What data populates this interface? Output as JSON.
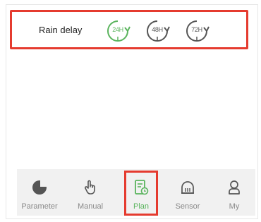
{
  "rain_delay": {
    "label": "Rain delay",
    "options": [
      {
        "label": "24H",
        "selected": true
      },
      {
        "label": "48H",
        "selected": false
      },
      {
        "label": "72H",
        "selected": false
      }
    ]
  },
  "tabbar": {
    "items": [
      {
        "label": "Parameter",
        "icon": "pie-chart-icon",
        "active": false
      },
      {
        "label": "Manual",
        "icon": "hand-pointer-icon",
        "active": false
      },
      {
        "label": "Plan",
        "icon": "plan-document-icon",
        "active": true
      },
      {
        "label": "Sensor",
        "icon": "sensor-icon",
        "active": false
      },
      {
        "label": "My",
        "icon": "user-icon",
        "active": false
      }
    ]
  },
  "colors": {
    "accent": "#5ab45d",
    "inactive": "#555555",
    "highlight": "#e53b2f"
  }
}
